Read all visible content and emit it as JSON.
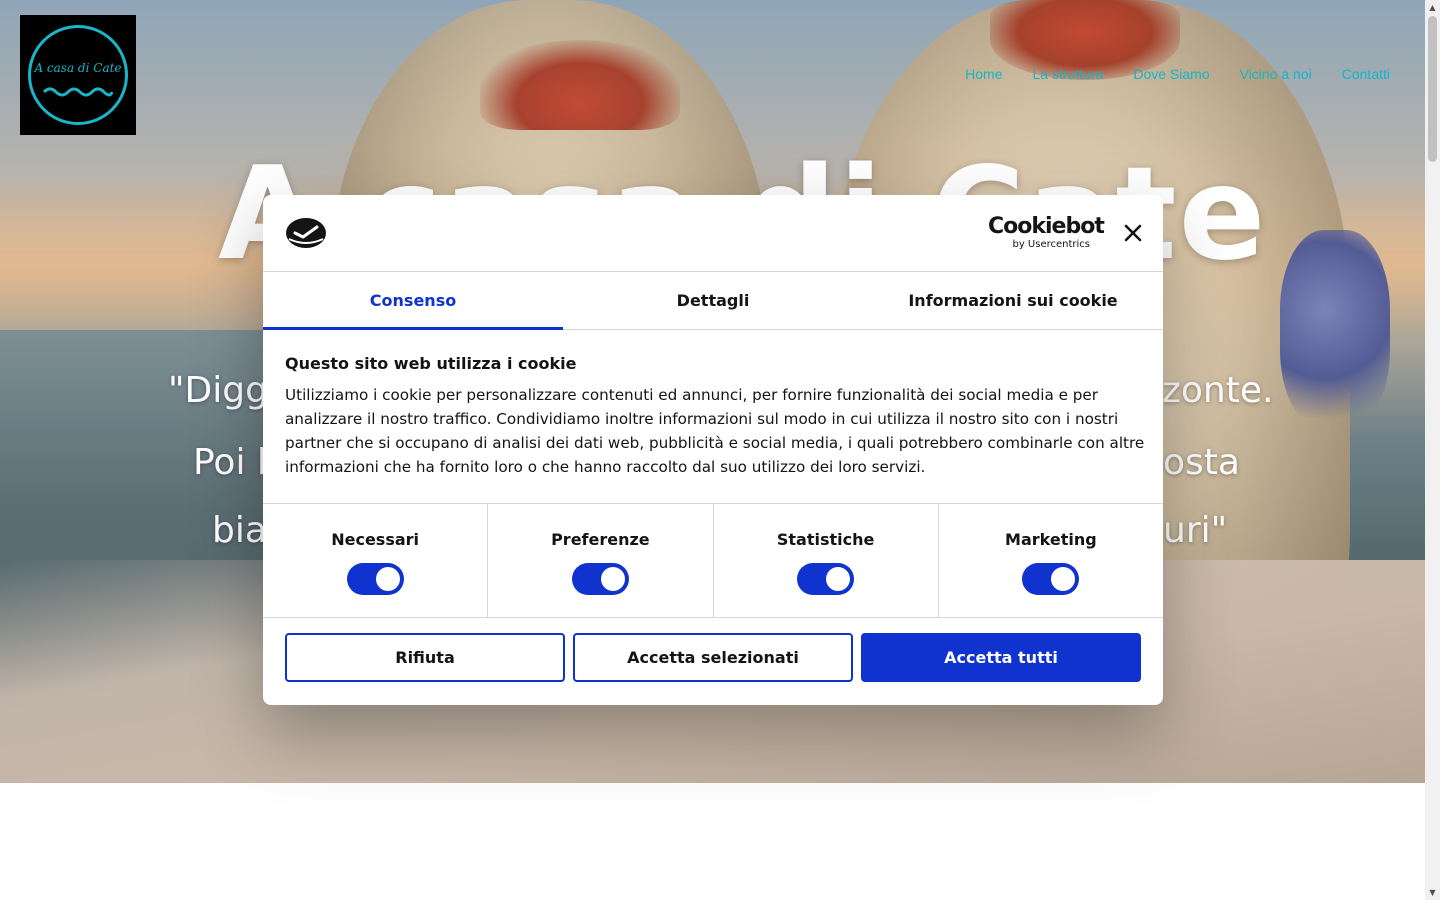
{
  "site": {
    "logo_text": "A casa di Cate",
    "hero_title": "A casa di Cate",
    "hero_quote_lines": [
      "\"Digg",
      "zonte.",
      "Poi l",
      "osta",
      "bia",
      "uri\""
    ]
  },
  "nav": {
    "items": [
      "Home",
      "La struttura",
      "Dove Siamo",
      "Vicino a noi",
      "Contatti"
    ]
  },
  "cookie_dialog": {
    "brand_main": "Cookiebot",
    "brand_sub": "by Usercentrics",
    "tabs": [
      "Consenso",
      "Dettagli",
      "Informazioni sui cookie"
    ],
    "active_tab": "Consenso",
    "heading": "Questo sito web utilizza i cookie",
    "body": "Utilizziamo i cookie per personalizzare contenuti ed annunci, per fornire funzionalità dei social media e per analizzare il nostro traffico. Condividiamo inoltre informazioni sul modo in cui utilizza il nostro sito con i nostri partner che si occupano di analisi dei dati web, pubblicità e social media, i quali potrebbero combinarle con altre informazioni che ha fornito loro o che hanno raccolto dal suo utilizzo dei loro servizi.",
    "toggles": [
      {
        "label": "Necessari",
        "on": true
      },
      {
        "label": "Preferenze",
        "on": true
      },
      {
        "label": "Statistiche",
        "on": true
      },
      {
        "label": "Marketing",
        "on": true
      }
    ],
    "buttons": {
      "reject": "Rifiuta",
      "accept_selected": "Accetta selezionati",
      "accept_all": "Accetta tutti"
    }
  },
  "colors": {
    "accent": "#1032cf",
    "nav_link": "#13b5c7",
    "logo_teal": "#19b6c9"
  },
  "icons": {
    "close": "close-icon",
    "cookiebot_mark": "cookiebot-logo-icon",
    "logo_waves": "waves-icon",
    "scroll_up": "scroll-up-arrow-icon",
    "scroll_down": "scroll-down-arrow-icon"
  }
}
